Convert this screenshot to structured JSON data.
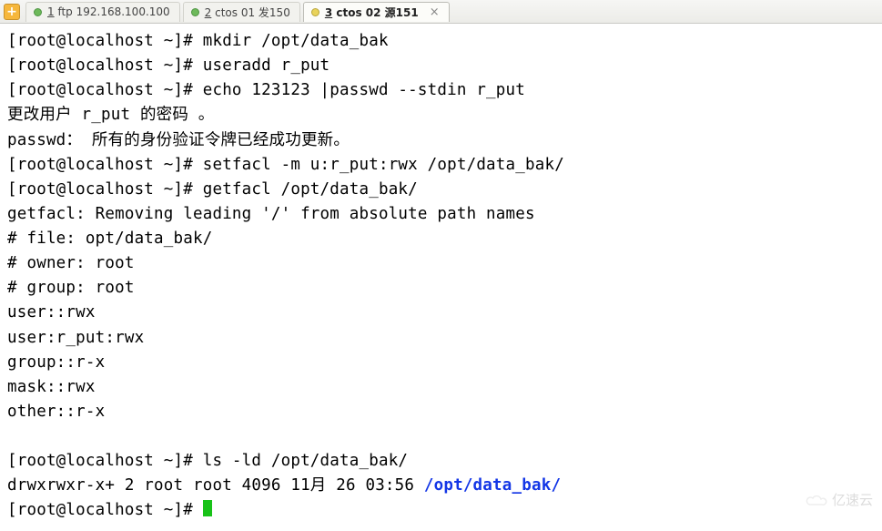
{
  "tabs": {
    "add_icon": "+",
    "items": [
      {
        "num": "1",
        "label_rest": " ftp 192.168.100.100",
        "dot": "green",
        "active": false
      },
      {
        "num": "2",
        "label_rest": " ctos 01 发150",
        "dot": "green",
        "active": false
      },
      {
        "num": "3",
        "label_rest": " ctos 02 源151",
        "dot": "ylw",
        "active": true,
        "close": "×"
      }
    ]
  },
  "term": {
    "l1": "[root@localhost ~]# mkdir /opt/data_bak",
    "l2": "[root@localhost ~]# useradd r_put",
    "l3": "[root@localhost ~]# echo 123123 |passwd --stdin r_put",
    "l4": "更改用户 r_put 的密码 。",
    "l5": "passwd： 所有的身份验证令牌已经成功更新。",
    "l6": "[root@localhost ~]# setfacl -m u:r_put:rwx /opt/data_bak/",
    "l7": "[root@localhost ~]# getfacl /opt/data_bak/",
    "l8": "getfacl: Removing leading '/' from absolute path names",
    "l9": "# file: opt/data_bak/",
    "l10": "# owner: root",
    "l11": "# group: root",
    "l12": "user::rwx",
    "l13": "user:r_put:rwx",
    "l14": "group::r-x",
    "l15": "mask::rwx",
    "l16": "other::r-x",
    "l17": "",
    "l18": "[root@localhost ~]# ls -ld /opt/data_bak/",
    "l19a": "drwxrwxr-x+ 2 root root 4096 11月 26 03:56 ",
    "l19b": "/opt/data_bak/",
    "l20": "[root@localhost ~]# "
  },
  "watermark": "亿速云"
}
